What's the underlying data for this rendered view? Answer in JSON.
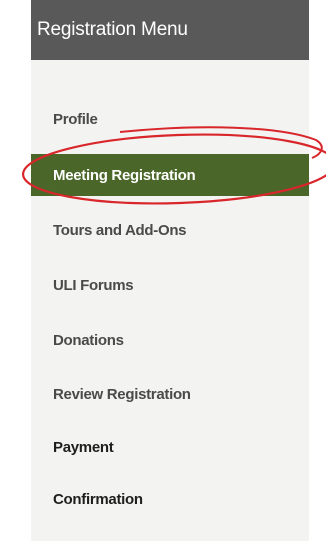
{
  "menu": {
    "title": "Registration Menu",
    "items": [
      {
        "label": "Profile",
        "state": "normal"
      },
      {
        "label": "Meeting Registration",
        "state": "active"
      },
      {
        "label": "Tours and Add-Ons",
        "state": "normal"
      },
      {
        "label": "ULI Forums",
        "state": "normal"
      },
      {
        "label": "Donations",
        "state": "normal"
      },
      {
        "label": "Review Registration",
        "state": "normal"
      },
      {
        "label": "Payment",
        "state": "normal"
      },
      {
        "label": "Confirmation",
        "state": "normal"
      }
    ]
  },
  "colors": {
    "header_bg": "#595959",
    "menu_bg": "#f3f3f1",
    "active_bg": "#4a6628",
    "highlight": "#d9262b"
  }
}
